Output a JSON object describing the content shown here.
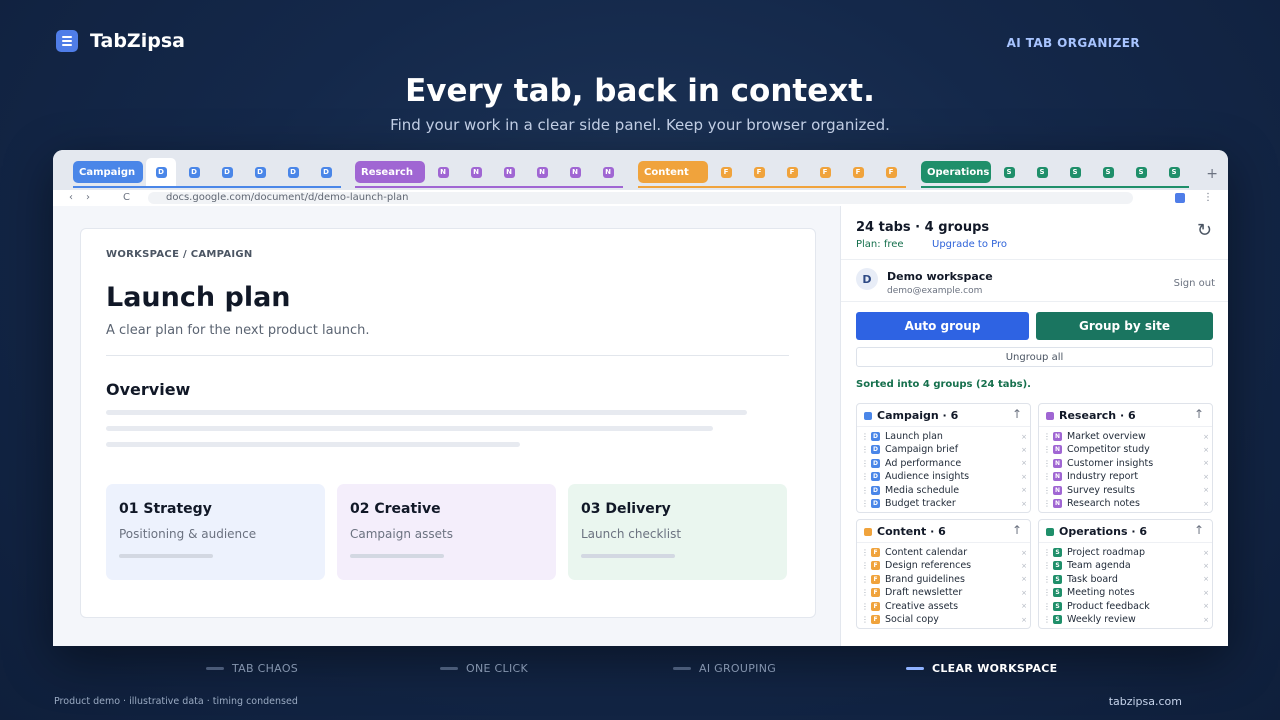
{
  "app": {
    "name": "TabZipsa",
    "tagline": "AI TAB ORGANIZER"
  },
  "hero": {
    "title": "Every tab, back in context.",
    "subtitle": "Find your work in a clear side panel. Keep your browser organized."
  },
  "colors": {
    "campaign": "#4a86e8",
    "research": "#a066d3",
    "content": "#f0a33c",
    "operations": "#1f8f6a",
    "auto_group": "#2e63e3",
    "group_by_site": "#1a7560"
  },
  "tabstrip": {
    "groups": [
      {
        "label": "Campaign",
        "letter": "D",
        "color": "#4a86e8",
        "tabs": 6
      },
      {
        "label": "Research",
        "letter": "N",
        "color": "#a066d3",
        "tabs": 6
      },
      {
        "label": "Content",
        "letter": "F",
        "color": "#f0a33c",
        "tabs": 6
      },
      {
        "label": "Operations",
        "letter": "S",
        "color": "#1f8f6a",
        "tabs": 6
      }
    ],
    "new_tab": "+"
  },
  "address_bar": {
    "back": "‹",
    "forward": "›",
    "reload": "C",
    "url": "docs.google.com/document/d/demo-launch-plan",
    "extension_icon": "extension-icon",
    "menu": "⋮"
  },
  "document": {
    "breadcrumb": "WORKSPACE  /  CAMPAIGN",
    "title": "Launch plan",
    "subtitle": "A clear plan for the next product launch.",
    "section": "Overview",
    "cards": [
      {
        "title": "01  Strategy",
        "subtitle": "Positioning & audience",
        "bg": "#edf2fd"
      },
      {
        "title": "02  Creative",
        "subtitle": "Campaign assets",
        "bg": "#f4eefb"
      },
      {
        "title": "03  Delivery",
        "subtitle": "Launch checklist",
        "bg": "#eaf6ef"
      }
    ]
  },
  "panel": {
    "summary": "24 tabs · 4 groups",
    "plan": "Plan: free",
    "upgrade": "Upgrade to Pro",
    "refresh_icon": "refresh-icon",
    "account": {
      "initial": "D",
      "name": "Demo workspace",
      "email": "demo@example.com",
      "sign_out": "Sign out"
    },
    "auto_group": "Auto group",
    "group_by_site": "Group by site",
    "ungroup_all": "Ungroup all",
    "status": "Sorted into 4 groups (24 tabs).",
    "groups": [
      {
        "name": "Campaign · 6",
        "letter": "D",
        "color": "#4a86e8",
        "tabs": [
          "Launch plan",
          "Campaign brief",
          "Ad performance",
          "Audience insights",
          "Media schedule",
          "Budget tracker"
        ]
      },
      {
        "name": "Research · 6",
        "letter": "N",
        "color": "#a066d3",
        "tabs": [
          "Market overview",
          "Competitor study",
          "Customer insights",
          "Industry report",
          "Survey results",
          "Research notes"
        ]
      },
      {
        "name": "Content · 6",
        "letter": "F",
        "color": "#f0a33c",
        "tabs": [
          "Content calendar",
          "Design references",
          "Brand guidelines",
          "Draft newsletter",
          "Creative assets",
          "Social copy"
        ]
      },
      {
        "name": "Operations · 6",
        "letter": "S",
        "color": "#1f8f6a",
        "tabs": [
          "Project roadmap",
          "Team agenda",
          "Task board",
          "Meeting notes",
          "Product feedback",
          "Weekly review"
        ]
      }
    ]
  },
  "steps": [
    {
      "label": "TAB CHAOS",
      "active": false
    },
    {
      "label": "ONE CLICK",
      "active": false
    },
    {
      "label": "AI GROUPING",
      "active": false
    },
    {
      "label": "CLEAR WORKSPACE",
      "active": true
    }
  ],
  "footer": {
    "left": "Product demo · illustrative data · timing condensed",
    "right": "tabzipsa.com"
  }
}
